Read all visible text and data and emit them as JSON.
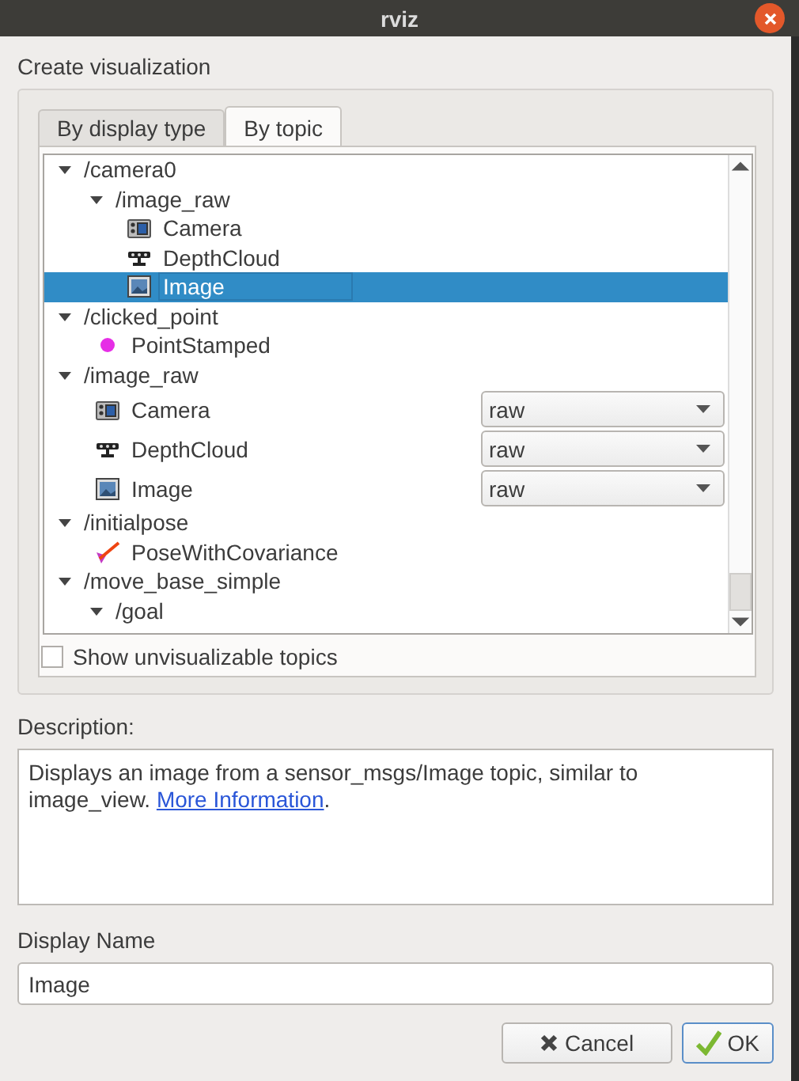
{
  "window": {
    "title": "rviz"
  },
  "group_title": "Create visualization",
  "tabs": [
    {
      "label": "By display type",
      "selected": false
    },
    {
      "label": "By topic",
      "selected": true
    }
  ],
  "tree": {
    "items": [
      {
        "kind": "topic",
        "label": "/camera0",
        "expanded": true,
        "selected": false,
        "children": [
          {
            "kind": "topic",
            "label": "/image_raw",
            "expanded": true,
            "selected": false,
            "children": [
              {
                "kind": "camera",
                "label": "Camera",
                "selected": false
              },
              {
                "kind": "depth_cloud",
                "label": "DepthCloud",
                "selected": false
              },
              {
                "kind": "image",
                "label": "Image",
                "selected": true
              }
            ]
          }
        ]
      },
      {
        "kind": "topic",
        "label": "/clicked_point",
        "expanded": true,
        "selected": false,
        "children": [
          {
            "kind": "point",
            "label": "PointStamped",
            "selected": false
          }
        ]
      },
      {
        "kind": "topic",
        "label": "/image_raw",
        "expanded": true,
        "selected": false,
        "children": [
          {
            "kind": "camera",
            "label": "Camera",
            "selected": false,
            "transport": "raw"
          },
          {
            "kind": "depth_cloud",
            "label": "DepthCloud",
            "selected": false,
            "transport": "raw"
          },
          {
            "kind": "image",
            "label": "Image",
            "selected": false,
            "transport": "raw"
          }
        ]
      },
      {
        "kind": "topic",
        "label": "/initialpose",
        "expanded": true,
        "selected": false,
        "children": [
          {
            "kind": "pose",
            "label": "PoseWithCovariance",
            "selected": false
          }
        ]
      },
      {
        "kind": "topic",
        "label": "/move_base_simple",
        "expanded": true,
        "selected": false,
        "children": [
          {
            "kind": "topic",
            "label": "/goal",
            "expanded": true,
            "selected": false
          }
        ]
      }
    ]
  },
  "show_unvisualizable": {
    "label": "Show unvisualizable topics",
    "checked": false
  },
  "description": {
    "label": "Description:",
    "text": "Displays an image from a sensor_msgs/Image topic, similar to image_view. ",
    "link": "More Information",
    "after": "."
  },
  "display_name": {
    "label": "Display Name",
    "value": "Image"
  },
  "buttons": [
    {
      "kind": "cancel",
      "label": "Cancel"
    },
    {
      "kind": "ok",
      "label": "OK"
    }
  ]
}
